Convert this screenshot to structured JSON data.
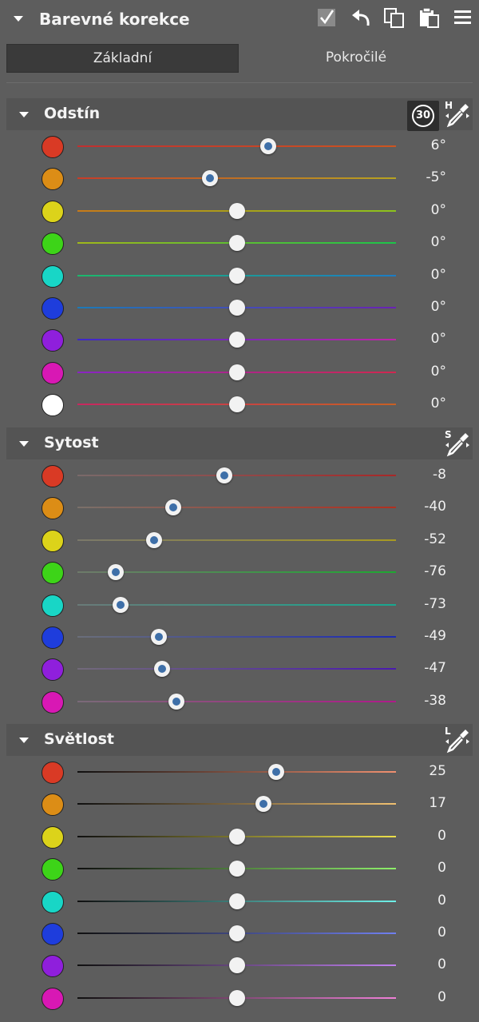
{
  "header": {
    "title": "Barevné korekce",
    "icons": [
      "checkmark-icon",
      "undo-icon",
      "copy-icon",
      "paste-icon",
      "menu-icon"
    ]
  },
  "tabs": [
    {
      "label": "Základní",
      "active": true
    },
    {
      "label": "Pokročilé",
      "active": false
    }
  ],
  "sections": [
    {
      "key": "hue",
      "title": "Odstín",
      "badge": "30",
      "picker_letter": "H",
      "range": [
        -30,
        30
      ],
      "rows": [
        {
          "name": "red",
          "color": "#d93a25",
          "value": 6,
          "label": "6°",
          "track": [
            "#c03030",
            "#cc5520"
          ]
        },
        {
          "name": "orange",
          "color": "#dc8d16",
          "value": -5,
          "label": "-5°",
          "track": [
            "#c83c28",
            "#b8a420"
          ]
        },
        {
          "name": "yellow",
          "color": "#dcd31a",
          "value": 0,
          "label": "0°",
          "track": [
            "#c87a18",
            "#8cc41c"
          ]
        },
        {
          "name": "green",
          "color": "#3dd418",
          "value": 0,
          "label": "0°",
          "track": [
            "#a0b81a",
            "#1cc44a"
          ]
        },
        {
          "name": "aqua",
          "color": "#18d6c6",
          "value": 0,
          "label": "0°",
          "track": [
            "#1cb86c",
            "#1c7cc4"
          ]
        },
        {
          "name": "blue",
          "color": "#1e3ddc",
          "value": 0,
          "label": "0°",
          "track": [
            "#1c7ab8",
            "#6a22b4"
          ]
        },
        {
          "name": "purple",
          "color": "#8f1fdc",
          "value": 0,
          "label": "0°",
          "track": [
            "#3c28c8",
            "#c024a8"
          ]
        },
        {
          "name": "magenta",
          "color": "#d818b4",
          "value": 0,
          "label": "0°",
          "track": [
            "#8a24c4",
            "#d02850"
          ]
        },
        {
          "name": "skin",
          "color": "#ffffff",
          "value": 0,
          "label": "0°",
          "track": [
            "#c82860",
            "#c86024"
          ]
        }
      ]
    },
    {
      "key": "saturation",
      "title": "Sytost",
      "picker_letter": "S",
      "range": [
        -100,
        100
      ],
      "rows": [
        {
          "name": "red",
          "color": "#d93a25",
          "value": -8,
          "label": "-8",
          "track": [
            "#7a6a6a",
            "#a82828"
          ]
        },
        {
          "name": "orange",
          "color": "#dc8d16",
          "value": -40,
          "label": "-40",
          "track": [
            "#7a706a",
            "#b03020"
          ]
        },
        {
          "name": "yellow",
          "color": "#dcd31a",
          "value": -52,
          "label": "-52",
          "track": [
            "#7a786a",
            "#a89a22"
          ]
        },
        {
          "name": "green",
          "color": "#3dd418",
          "value": -76,
          "label": "-76",
          "track": [
            "#6e7a6a",
            "#1ea832"
          ]
        },
        {
          "name": "aqua",
          "color": "#18d6c6",
          "value": -73,
          "label": "-73",
          "track": [
            "#6a7a78",
            "#18a890"
          ]
        },
        {
          "name": "blue",
          "color": "#1e3ddc",
          "value": -49,
          "label": "-49",
          "track": [
            "#6a6e7a",
            "#1c2ab4"
          ]
        },
        {
          "name": "purple",
          "color": "#8f1fdc",
          "value": -47,
          "label": "-47",
          "track": [
            "#726a7a",
            "#4a1ab0"
          ]
        },
        {
          "name": "magenta",
          "color": "#d818b4",
          "value": -38,
          "label": "-38",
          "track": [
            "#7a6a78",
            "#b01a8a"
          ]
        }
      ]
    },
    {
      "key": "lightness",
      "title": "Světlost",
      "picker_letter": "L",
      "range": [
        -100,
        100
      ],
      "rows": [
        {
          "name": "red",
          "color": "#d93a25",
          "value": 25,
          "label": "25",
          "track": [
            "#101010",
            "#f09070"
          ]
        },
        {
          "name": "orange",
          "color": "#dc8d16",
          "value": 17,
          "label": "17",
          "track": [
            "#101010",
            "#f0c070"
          ]
        },
        {
          "name": "yellow",
          "color": "#dcd31a",
          "value": 0,
          "label": "0",
          "track": [
            "#101010",
            "#ece04a"
          ]
        },
        {
          "name": "green",
          "color": "#3dd418",
          "value": 0,
          "label": "0",
          "track": [
            "#101010",
            "#8ef06a"
          ]
        },
        {
          "name": "aqua",
          "color": "#18d6c6",
          "value": 0,
          "label": "0",
          "track": [
            "#101010",
            "#6ef0e8"
          ]
        },
        {
          "name": "blue",
          "color": "#1e3ddc",
          "value": 0,
          "label": "0",
          "track": [
            "#101010",
            "#7080f0"
          ]
        },
        {
          "name": "purple",
          "color": "#8f1fdc",
          "value": 0,
          "label": "0",
          "track": [
            "#101010",
            "#c080f0"
          ]
        },
        {
          "name": "magenta",
          "color": "#d818b4",
          "value": 0,
          "label": "0",
          "track": [
            "#101010",
            "#f080d8"
          ]
        }
      ]
    }
  ]
}
